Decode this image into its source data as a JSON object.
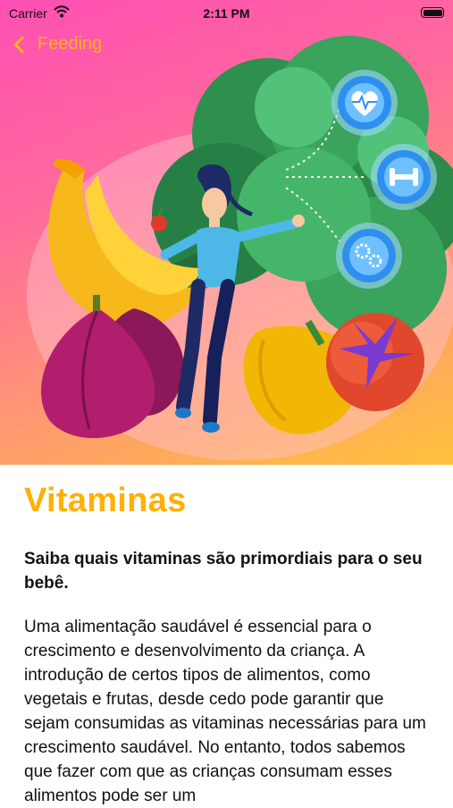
{
  "status_bar": {
    "carrier": "Carrier",
    "time": "2:11 PM",
    "icons": [
      "wifi-icon",
      "battery-icon"
    ]
  },
  "nav": {
    "back_label": "Feeding",
    "back_icon": "chevron-left-icon",
    "accent_color": "#ffb21f"
  },
  "hero": {
    "description_icons": [
      "heart-rate-icon",
      "dumbbell-icon",
      "gears-icon"
    ]
  },
  "article": {
    "title": "Vitaminas",
    "subtitle": "Saiba quais vitaminas são primordiais para o seu bebê.",
    "body": "Uma alimentação saudável é essencial para o crescimento e desenvolvimento da criança. A introdução de certos tipos de alimentos, como vegetais e frutas, desde cedo pode garantir que sejam consumidas as vitaminas necessárias para um crescimento saudável. No entanto, todos sabemos que fazer com que as crianças consumam esses alimentos pode ser um",
    "title_color": "#ffb000"
  }
}
